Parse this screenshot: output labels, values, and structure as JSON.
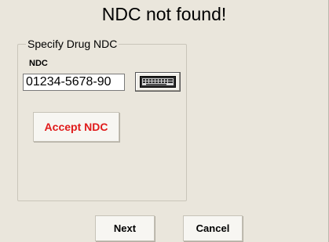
{
  "dialog": {
    "title": "NDC not found!"
  },
  "group": {
    "legend": "Specify Drug NDC",
    "ndc_label": "NDC",
    "ndc_value": "01234-5678-90",
    "keyboard_icon": "keyboard-icon",
    "accept_label": "Accept NDC"
  },
  "buttons": {
    "next_label": "Next",
    "cancel_label": "Cancel"
  },
  "colors": {
    "background": "#eae6dc",
    "accept_text": "#e01a1a"
  }
}
